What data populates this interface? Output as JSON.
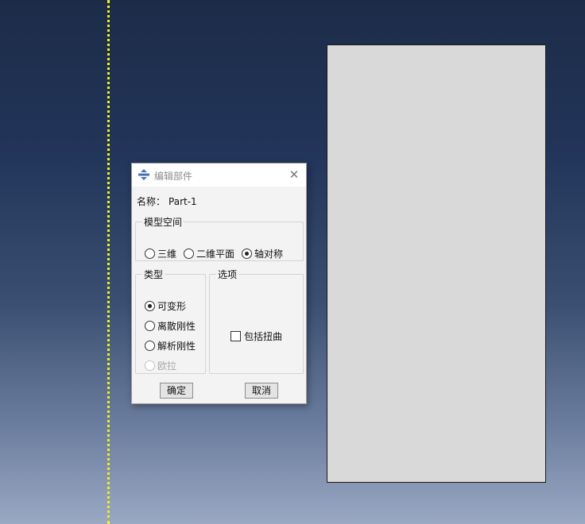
{
  "dialog": {
    "title": "编辑部件",
    "name_label": "名称：",
    "name_value": "Part-1",
    "model_space": {
      "legend": "模型空间",
      "options": [
        "三维",
        "二维平面",
        "轴对称"
      ],
      "selected": "轴对称"
    },
    "type": {
      "legend": "类型",
      "options": [
        "可变形",
        "离散刚性",
        "解析刚性",
        "欧拉"
      ],
      "selected": "可变形",
      "disabled": "欧拉"
    },
    "options_group": {
      "legend": "选项",
      "include_twist_label": "包括扭曲",
      "include_twist_checked": false
    },
    "ok_label": "确定",
    "cancel_label": "取消"
  },
  "colors": {
    "viewport_top": "#1c2c48",
    "viewport_bottom": "#9aa8c2",
    "axis_line": "#f0f020",
    "part_fill": "#d9d9d9"
  },
  "icons": {
    "title": "part-module-icon",
    "close": "close-icon"
  }
}
